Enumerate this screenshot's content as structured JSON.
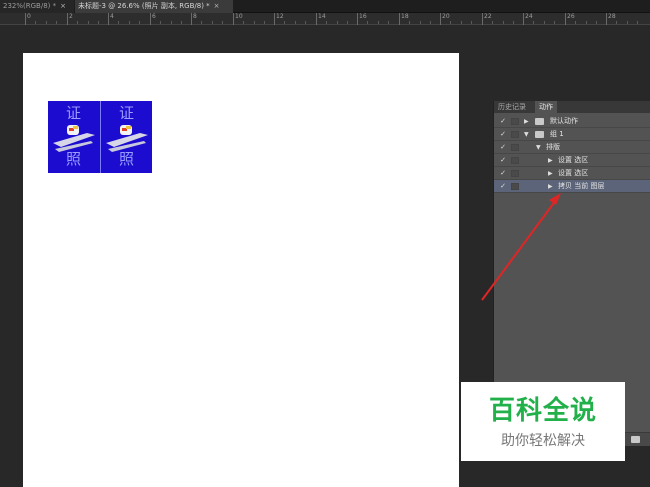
{
  "tabs": [
    {
      "label": "232%(RGB/8) *",
      "close": "×"
    },
    {
      "label": "未标题-3 @ 26.6% (照片 副本, RGB/8) *",
      "close": "×"
    }
  ],
  "ruler": {
    "labels": [
      "0",
      "2",
      "4",
      "6",
      "8",
      "10",
      "12",
      "14",
      "16",
      "18",
      "20",
      "22",
      "24",
      "26",
      "28",
      "30"
    ]
  },
  "photo": {
    "top_char": "证",
    "bottom_char": "照",
    "color": "#1b0ccf"
  },
  "panel": {
    "tab_history": "历史记录",
    "tab_actions": "动作",
    "rows": [
      {
        "check": "✓",
        "indent": 0,
        "tri": "▶",
        "folder": true,
        "label": "默认动作"
      },
      {
        "check": "✓",
        "indent": 0,
        "tri": "▼",
        "folder": true,
        "label": "组 1"
      },
      {
        "check": "✓",
        "indent": 1,
        "tri": "▼",
        "folder": false,
        "label": "排版"
      },
      {
        "check": "✓",
        "indent": 2,
        "tri": "▶",
        "folder": false,
        "label": "设置 选区"
      },
      {
        "check": "✓",
        "indent": 2,
        "tri": "▶",
        "folder": false,
        "label": "设置 选区"
      },
      {
        "check": "✓",
        "indent": 2,
        "tri": "▶",
        "folder": false,
        "label": "拷贝 当前 图层",
        "selected": true
      }
    ]
  },
  "watermark": {
    "title": "百科全说",
    "subtitle": "助你轻松解决"
  }
}
